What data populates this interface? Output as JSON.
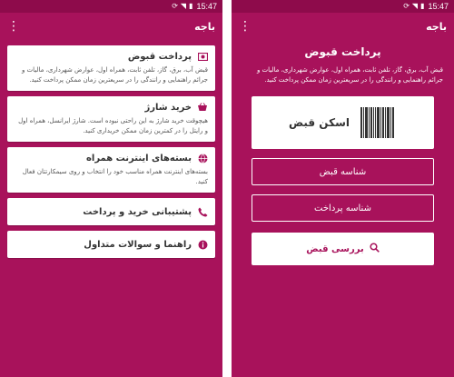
{
  "status_bar": {
    "time": "15:47"
  },
  "app": {
    "title": "باجه"
  },
  "home_cards": [
    {
      "title": "پرداخت قبوض",
      "desc": "قبض آب، برق، گاز، تلفن ثابت، همراه اول، عوارض شهرداری، مالیات و جرائم راهنمایی و رانندگی را در سریعترین زمان ممکن پرداخت کنید.",
      "icon": "bill-icon"
    },
    {
      "title": "خرید شارژ",
      "desc": "هیچوقت خرید شارژ به این راحتی نبوده است. شارژ ایرانسل، همراه اول و رایتل را در کمترین زمان ممکن خریداری کنید.",
      "icon": "basket-icon"
    },
    {
      "title": "بسته‌های اینترنت همراه",
      "desc": "بسته‌های اینترنت همراه مناسب خود را انتخاب و روی سیمکارتتان فعال کنید.",
      "icon": "globe-icon"
    },
    {
      "title": "پشتیبانی خرید و پرداخت",
      "desc": "",
      "icon": "phone-icon"
    },
    {
      "title": "راهنما و سوالات متداول",
      "desc": "",
      "icon": "info-icon"
    }
  ],
  "bill_payment": {
    "title": "پرداخت قبوض",
    "desc": "قبض آب، برق، گاز، تلفن ثابت، همراه اول، عوارض شهرداری، مالیات و جرائم راهنمایی و رانندگی را در سریعترین زمان ممکن پرداخت کنید.",
    "scan_label": "اسکن قبض",
    "bill_id_placeholder": "شناسه قبض",
    "payment_id_placeholder": "شناسه پرداخت",
    "inquire_label": "بررسی قبض"
  },
  "colors": {
    "primary": "#a8125b",
    "status": "#8e0b4b"
  }
}
